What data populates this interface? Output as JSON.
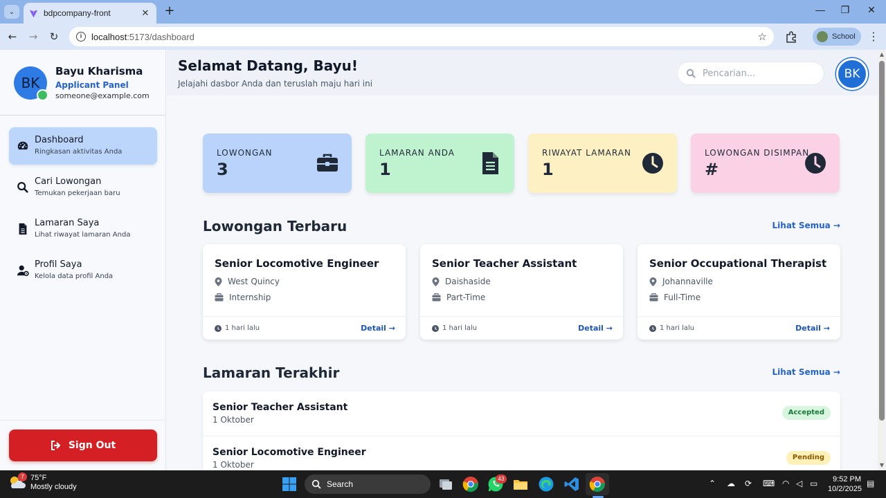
{
  "browser": {
    "tab_title": "bdpcompany-front",
    "url_host": "localhost",
    "url_rest": ":5173/dashboard",
    "profile_label": "School"
  },
  "sidebar": {
    "avatar_initials": "BK",
    "user_name": "Bayu Kharisma",
    "role": "Applicant Panel",
    "email": "someone@example.com",
    "items": [
      {
        "title": "Dashboard",
        "subtitle": "Ringkasan aktivitas Anda",
        "icon": "gauge-icon",
        "active": true
      },
      {
        "title": "Cari Lowongan",
        "subtitle": "Temukan pekerjaan baru",
        "icon": "search-icon",
        "active": false
      },
      {
        "title": "Lamaran Saya",
        "subtitle": "Lihat riwayat lamaran Anda",
        "icon": "file-icon",
        "active": false
      },
      {
        "title": "Profil Saya",
        "subtitle": "Kelola data profil Anda",
        "icon": "user-cog-icon",
        "active": false
      }
    ],
    "signout_label": "Sign Out"
  },
  "header": {
    "title": "Selamat Datang, Bayu!",
    "subtitle": "Jelajahi dasbor Anda dan teruslah maju hari ini",
    "search_placeholder": "Pencarian...",
    "avatar_initials": "BK"
  },
  "stats": [
    {
      "label": "LOWONGAN",
      "value": "3",
      "icon": "briefcase-icon",
      "color": "#b9d3fb"
    },
    {
      "label": "LAMARAN ANDA",
      "value": "1",
      "icon": "document-icon",
      "color": "#bff2cf"
    },
    {
      "label": "RIWAYAT LAMARAN",
      "value": "1",
      "icon": "clock-icon",
      "color": "#fdf0c2"
    },
    {
      "label": "LOWONGAN DISIMPAN",
      "value": "#",
      "icon": "clock-icon",
      "color": "#fbd1e6"
    }
  ],
  "latest_jobs": {
    "title": "Lowongan Terbaru",
    "see_all": "Lihat Semua →",
    "items": [
      {
        "title": "Senior Locomotive Engineer",
        "location": "West Quincy",
        "type": "Internship",
        "time": "1 hari lalu",
        "detail": "Detail →"
      },
      {
        "title": "Senior Teacher Assistant",
        "location": "Daishaside",
        "type": "Part-Time",
        "time": "1 hari lalu",
        "detail": "Detail →"
      },
      {
        "title": "Senior Occupational Therapist",
        "location": "Johannaville",
        "type": "Full-Time",
        "time": "1 hari lalu",
        "detail": "Detail →"
      }
    ]
  },
  "recent_applications": {
    "title": "Lamaran Terakhir",
    "see_all": "Lihat Semua →",
    "items": [
      {
        "title": "Senior Teacher Assistant",
        "date": "1 Oktober",
        "status": "Accepted"
      },
      {
        "title": "Senior Locomotive Engineer",
        "date": "1 Oktober",
        "status": "Pending"
      }
    ]
  },
  "taskbar": {
    "weather_temp": "75°F",
    "weather_desc": "Mostly cloudy",
    "weather_badge": "7",
    "search_label": "Search",
    "whatsapp_badge": "43",
    "time": "9:52 PM",
    "date": "10/2/2025"
  }
}
